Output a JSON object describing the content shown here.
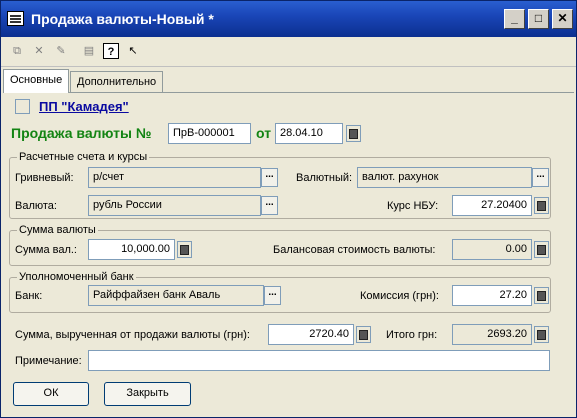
{
  "window": {
    "title": "Продажа валюты-Новый *",
    "buttons": {
      "minimize": "_",
      "maximize": "□",
      "close": "✕"
    }
  },
  "toolbar": {
    "icons": [
      "copy-icon",
      "delete-icon",
      "edit-icon",
      "view-icon",
      "help-icon",
      "pointer-help-icon"
    ]
  },
  "tabs": [
    {
      "label": "Основные",
      "active": true
    },
    {
      "label": "Дополнительно",
      "active": false
    }
  ],
  "header": {
    "org_name": "ПП \"Камадея\"",
    "doc_title": "Продажа валюты №",
    "doc_number": "ПрВ-000001",
    "from_label": "от",
    "doc_date": "28.04.10"
  },
  "accounts": {
    "group_title": "Расчетные счета и курсы",
    "uah_label": "Гривневый:",
    "uah_value": "р/счет",
    "fx_label": "Валютный:",
    "fx_value": "валют. рахунок",
    "currency_label": "Валюта:",
    "currency_value": "рубль России",
    "rate_label": "Курс НБУ:",
    "rate_value": "27.20400"
  },
  "amount": {
    "group_title": "Сумма валюты",
    "sum_label": "Сумма вал.:",
    "sum_value": "10,000.00",
    "balance_label": "Балансовая стоимость валюты:",
    "balance_value": "0.00"
  },
  "bank": {
    "group_title": "Уполномоченный банк",
    "bank_label": "Банк:",
    "bank_value": "Райффайзен банк Аваль",
    "commission_label": "Комиссия (грн):",
    "commission_value": "27.20"
  },
  "totals": {
    "proceeds_label": "Сумма, вырученная от продажи валюты (грн):",
    "proceeds_value": "2720.40",
    "total_label": "Итого грн:",
    "total_value": "2693.20",
    "note_label": "Примечание:",
    "note_value": ""
  },
  "footer": {
    "ok_label": "ОК",
    "close_label": "Закрыть"
  }
}
